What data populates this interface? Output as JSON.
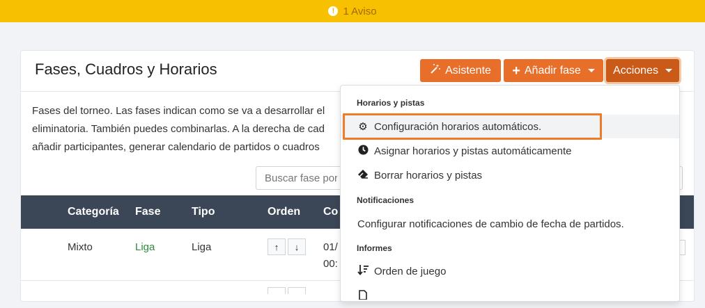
{
  "warning": {
    "text": "1 Aviso",
    "icon": "exclamation-circle-icon"
  },
  "header": {
    "title": "Fases, Cuadros y Horarios",
    "buttons": {
      "asistente": "Asistente",
      "anadir_fase": "Añadir fase",
      "acciones": "Acciones"
    }
  },
  "description": {
    "lines": [
      "Fases del torneo. Las fases indican como se va a desarrollar el",
      "eliminatoria. También puedes combinarlas. A la derecha de cad",
      "añadir participantes, generar calendario de partidos o cuadros"
    ]
  },
  "search": {
    "placeholder": "Buscar fase por"
  },
  "table": {
    "columns": [
      "Categoría",
      "Fase",
      "Tipo",
      "Orden",
      "Co"
    ],
    "rows": [
      {
        "categoria": "Mixto",
        "fase": "Liga",
        "tipo": "Liga",
        "fecha_1": "01/",
        "fecha_2": "00:"
      }
    ]
  },
  "dropdown": {
    "sections": [
      {
        "title": "Horarios y pistas",
        "items": [
          {
            "label": "Configuración horarios automáticos.",
            "icon": "gear-icon"
          },
          {
            "label": "Asignar horarios y pistas automáticamente",
            "icon": "clock-icon"
          },
          {
            "label": "Borrar horarios y pistas",
            "icon": "eraser-icon"
          }
        ]
      },
      {
        "title": "Notificaciones",
        "items": [
          {
            "label": "Configurar notificaciones de cambio de fecha de partidos."
          }
        ]
      },
      {
        "title": "Informes",
        "items": [
          {
            "label": "Orden de juego",
            "icon": "sort-amount-icon"
          }
        ]
      }
    ]
  },
  "colors": {
    "warning_bar": "#f7c000",
    "primary_button": "#e86f2a",
    "active_button": "#c95a17",
    "table_header": "#3b4656",
    "highlight": "#ee7a2a",
    "fase_link": "#2e8b3e"
  }
}
